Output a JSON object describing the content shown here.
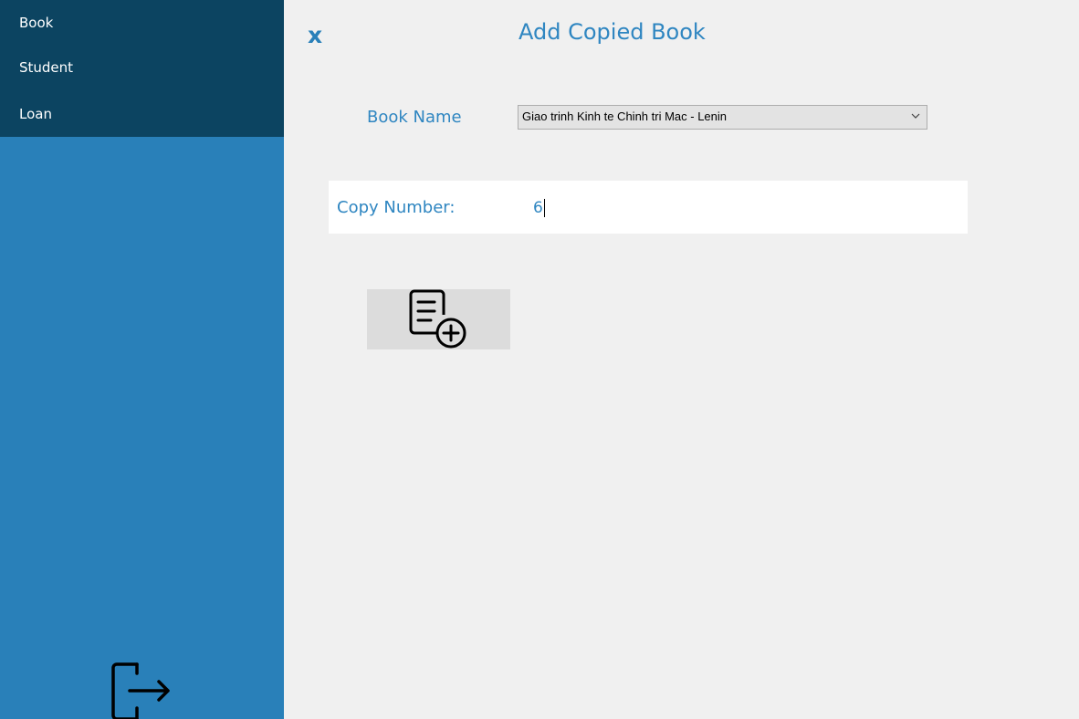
{
  "sidebar": {
    "items": [
      {
        "label": "Book"
      },
      {
        "label": "Student"
      },
      {
        "label": "Loan"
      }
    ],
    "exit_icon": "logout-icon"
  },
  "form": {
    "close_label": "x",
    "title": "Add Copied Book",
    "book_name_label": "Book Name",
    "book_name_selected": "Giao trinh Kinh te Chinh tri Mac - Lenin",
    "copy_number_label": "Copy Number:",
    "copy_number_value": "6",
    "add_button_icon": "add-document-icon"
  },
  "colors": {
    "sidebar_dark": "#0c4461",
    "sidebar_blue": "#2980b9",
    "accent_text": "#2f86c1",
    "background": "#f0f0f0"
  }
}
